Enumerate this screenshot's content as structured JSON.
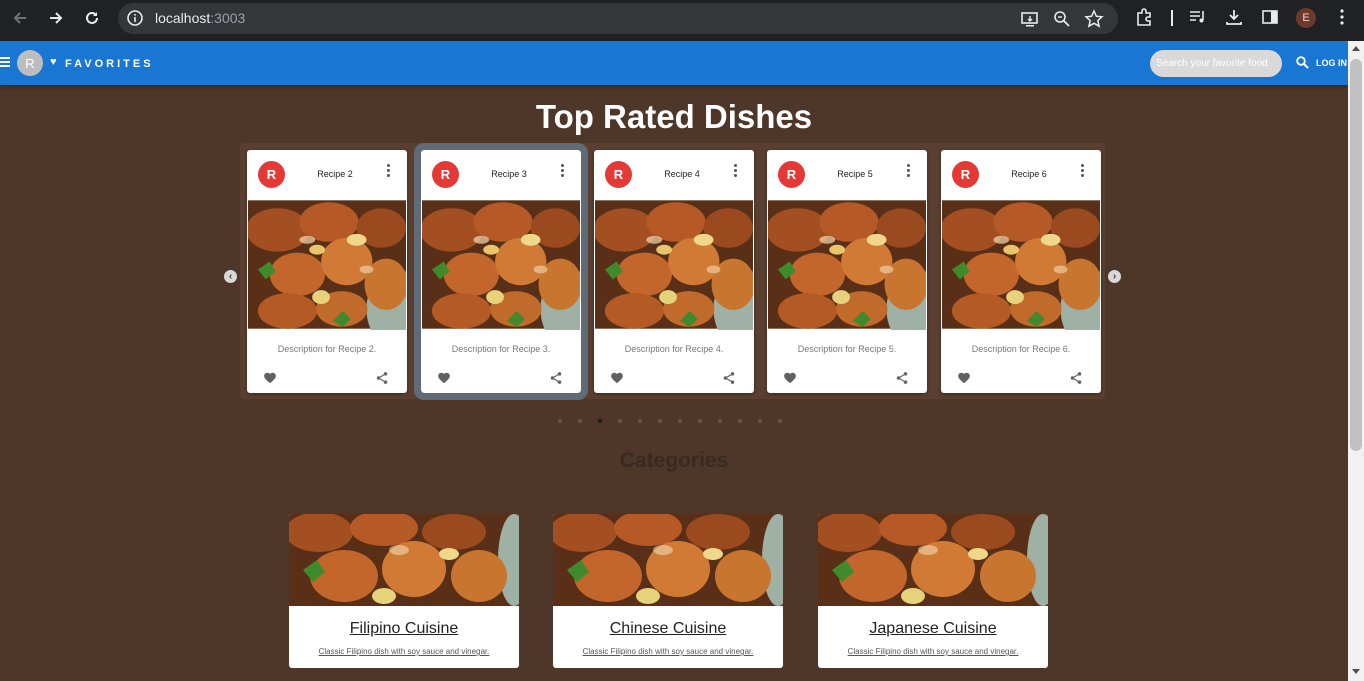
{
  "browser": {
    "url_host": "localhost",
    "url_port": ":3003",
    "profile_initial": "E"
  },
  "appbar": {
    "avatar_initial": "R",
    "brand": "FAVORITES",
    "search_placeholder": "Search your favorite food",
    "login": "LOG IN"
  },
  "main": {
    "title": "Top Rated Dishes",
    "recipes": [
      {
        "avatar": "R",
        "title": "Recipe 2",
        "description": "Description for Recipe 2."
      },
      {
        "avatar": "R",
        "title": "Recipe 3",
        "description": "Description for Recipe 3."
      },
      {
        "avatar": "R",
        "title": "Recipe 4",
        "description": "Description for Recipe 4."
      },
      {
        "avatar": "R",
        "title": "Recipe 5",
        "description": "Description for Recipe 5."
      },
      {
        "avatar": "R",
        "title": "Recipe 6",
        "description": "Description for Recipe 6."
      }
    ],
    "active_recipe_index": 1,
    "dots_count": 12,
    "active_dot_index": 2,
    "categories_heading": "Categories",
    "categories": [
      {
        "title": "Filipino Cuisine",
        "description": "Classic Filipino dish with soy sauce and vinegar."
      },
      {
        "title": "Chinese Cuisine",
        "description": "Classic Filipino dish with soy sauce and vinegar."
      },
      {
        "title": "Japanese Cuisine",
        "description": "Classic Filipino dish with soy sauce and vinegar."
      }
    ]
  },
  "colors": {
    "appbar": "#1976d2",
    "background": "#4e3629",
    "avatar_red": "#e53935"
  }
}
